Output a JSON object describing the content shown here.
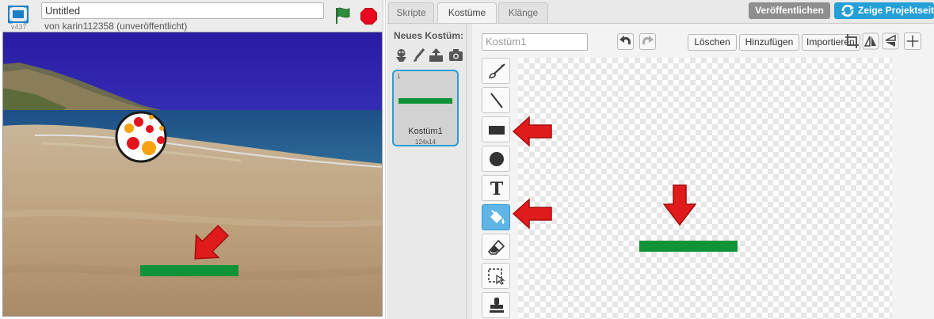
{
  "stage": {
    "project_title": "Untitled",
    "author_line": "von karin112358 (unveröffentlicht)",
    "version": "v437"
  },
  "editor": {
    "tabs": [
      {
        "label": "Skripte",
        "active": false
      },
      {
        "label": "Kostüme",
        "active": true
      },
      {
        "label": "Klänge",
        "active": false
      }
    ],
    "publish_label": "Veröffentlichen",
    "see_project_label": "Zeige Projektseite",
    "new_costume_label": "Neues Kostüm:",
    "new_costume_icons": [
      "library-icon",
      "paint-brush-icon",
      "upload-icon",
      "camera-icon"
    ],
    "costumes": [
      {
        "index": "1",
        "name": "Kostüm1",
        "size": "124x14",
        "selected": true
      }
    ],
    "costume_name_value": "",
    "costume_name_placeholder": "Kostüm1",
    "buttons": {
      "clear": "Löschen",
      "add": "Hinzufügen",
      "import": "Importieren"
    },
    "tools": [
      {
        "name": "brush-tool",
        "icon": "brush-icon",
        "selected": false
      },
      {
        "name": "line-tool",
        "icon": "line-icon",
        "selected": false
      },
      {
        "name": "rectangle-tool",
        "icon": "rectangle-icon",
        "selected": false
      },
      {
        "name": "ellipse-tool",
        "icon": "ellipse-icon",
        "selected": false
      },
      {
        "name": "text-tool",
        "icon": "text-icon",
        "selected": false,
        "glyph": "T"
      },
      {
        "name": "fill-tool",
        "icon": "paint-bucket-icon",
        "selected": true
      },
      {
        "name": "eraser-tool",
        "icon": "eraser-icon",
        "selected": false
      },
      {
        "name": "select-tool",
        "icon": "select-icon",
        "selected": false
      },
      {
        "name": "stamp-tool",
        "icon": "stamp-icon",
        "selected": false
      }
    ]
  },
  "colors": {
    "paddle_green": "#0e9336",
    "annotation_red": "#e01b1b",
    "accent_blue": "#259fd7",
    "stop_red": "#e8091e",
    "flag_green": "#2f8e3c"
  }
}
